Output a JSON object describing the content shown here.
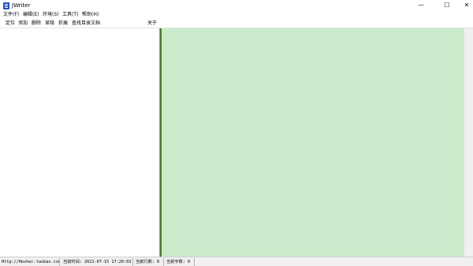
{
  "window": {
    "title": "JWriter",
    "icon": "document-icon",
    "controls": {
      "minimize": "—",
      "maximize": "☐",
      "close": "✕"
    }
  },
  "menubar": {
    "items": [
      "文件(F)",
      "编辑(E)",
      "环境(S)",
      "工具(T)",
      "帮助(H)"
    ]
  },
  "toolbar": {
    "items": [
      "定位",
      "添加",
      "删除",
      "显隐",
      "折展",
      "查找目录文档",
      "关于"
    ]
  },
  "editor": {
    "background": "#c9ebcb",
    "splitter_color": "#4d7a2e"
  },
  "statusbar": {
    "link": "Http://Hexher.taobao.com",
    "time": "当前时间: 2021-07-15 17:20:03",
    "line": "当前行数: 0",
    "chars": "当前字数: 0"
  }
}
